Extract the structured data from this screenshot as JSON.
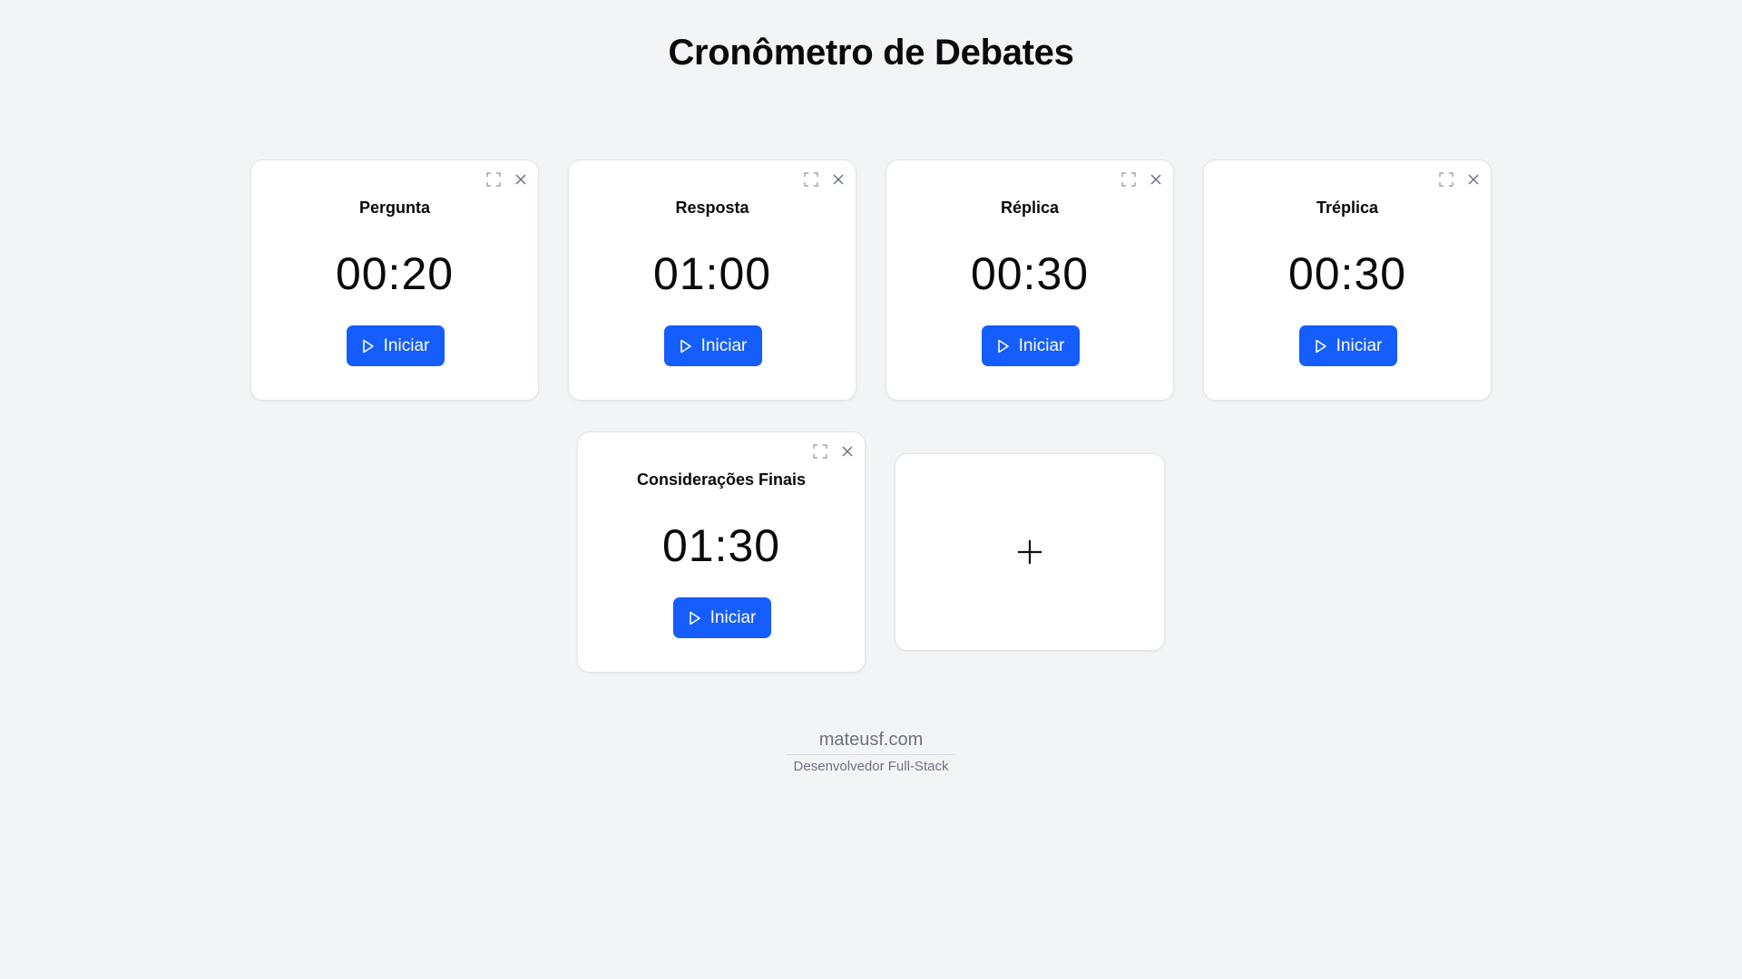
{
  "page": {
    "title": "Cronômetro de Debates"
  },
  "timers": [
    {
      "title": "Pergunta",
      "time": "00:20",
      "start_label": "Iniciar"
    },
    {
      "title": "Resposta",
      "time": "01:00",
      "start_label": "Iniciar"
    },
    {
      "title": "Réplica",
      "time": "00:30",
      "start_label": "Iniciar"
    },
    {
      "title": "Tréplica",
      "time": "00:30",
      "start_label": "Iniciar"
    },
    {
      "title": "Considerações Finais",
      "time": "01:30",
      "start_label": "Iniciar"
    }
  ],
  "icons": {
    "fullscreen": "fullscreen-icon",
    "close": "close-icon",
    "play": "play-icon",
    "add": "plus-icon"
  },
  "colors": {
    "accent": "#155dfc",
    "background": "#f3f4f6",
    "card": "#ffffff",
    "muted": "#6b7280"
  },
  "footer": {
    "site": "mateusf.com",
    "role": "Desenvolvedor Full-Stack"
  }
}
